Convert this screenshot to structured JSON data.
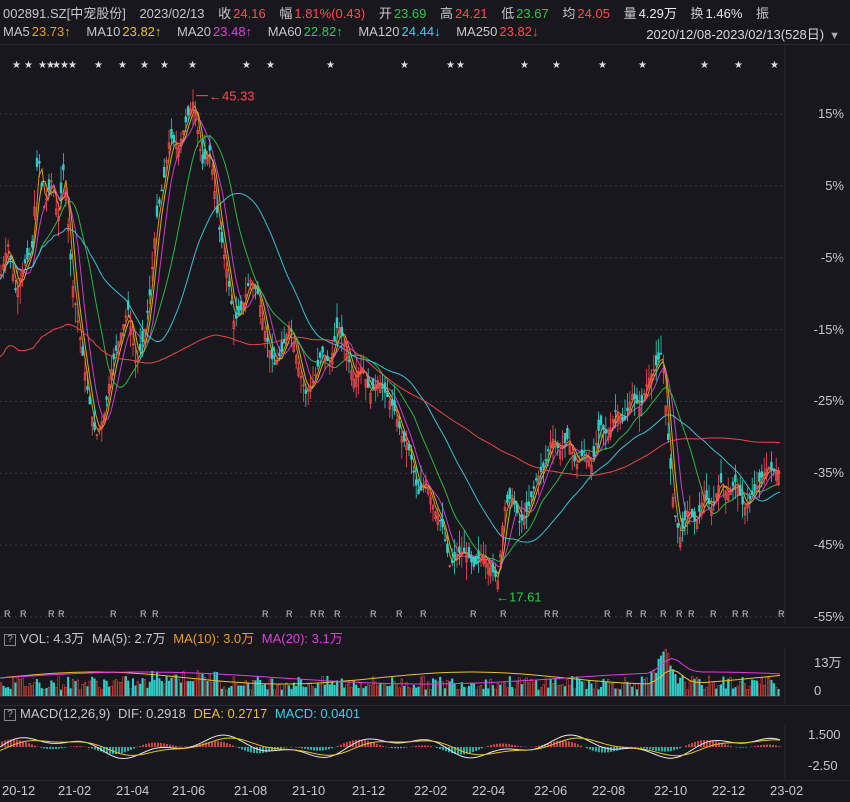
{
  "quote": {
    "symbol": "002891.SZ[中宠股份]",
    "date": "2023/02/13",
    "close_label": "收",
    "close": "24.16",
    "change_label": "幅",
    "change": "1.81%(0.43)",
    "open_label": "开",
    "open": "23.69",
    "high_label": "高",
    "high": "24.21",
    "low_label": "低",
    "low": "23.67",
    "avg_label": "均",
    "avg": "24.05",
    "vol_label": "量",
    "vol": "4.29万",
    "turnover_label": "换",
    "turnover": "1.46%",
    "amp_label": "振"
  },
  "ma": [
    {
      "name": "MA5",
      "value": "23.73↑",
      "color": "#f39b1d"
    },
    {
      "name": "MA10",
      "value": "23.82↑",
      "color": "#e6c32c"
    },
    {
      "name": "MA20",
      "value": "23.48↑",
      "color": "#e23de2"
    },
    {
      "name": "MA60",
      "value": "22.82↑",
      "color": "#2ec84a"
    },
    {
      "name": "MA120",
      "value": "24.44↓",
      "color": "#3fd0e8"
    },
    {
      "name": "MA250",
      "value": "23.82↓",
      "color": "#ff4d4d"
    }
  ],
  "range_label": "2020/12/08-2023/02/13(528日)",
  "price_axis": [
    "15%",
    "5%",
    "-5%",
    "-15%",
    "-25%",
    "-35%",
    "-45%",
    "-55%"
  ],
  "high_marker": "45.33",
  "low_marker": "17.61",
  "vol_panel": {
    "toggle": "?",
    "vol": "VOL: 4.3万",
    "ma5": "MA(5): 2.7万",
    "ma10": "MA(10): 3.0万",
    "ma20": "MA(20): 3.1万",
    "axis_top": "13万",
    "axis_zero": "0"
  },
  "macd_panel": {
    "toggle": "?",
    "name": "MACD(12,26,9)",
    "dif": "DIF: 0.2918",
    "dea": "DEA: 0.2717",
    "macd": "MACD: 0.0401",
    "axis_top": "1.500",
    "axis_bottom": "-2.50"
  },
  "x_axis": [
    "20-12",
    "21-02",
    "21-04",
    "21-06",
    "21-08",
    "21-10",
    "21-12",
    "22-02",
    "22-04",
    "22-06",
    "22-08",
    "22-10",
    "22-12",
    "23-02"
  ],
  "chart_data": {
    "type": "candlestick",
    "x_range": [
      "2020/12/08",
      "2023/02/13"
    ],
    "y_axis_percent": [
      15,
      5,
      -5,
      -15,
      -25,
      -35,
      -45,
      -55
    ],
    "high": 45.33,
    "low": 17.61,
    "close_path_percent": [
      [
        0,
        -8
      ],
      [
        8,
        -3
      ],
      [
        16,
        -10
      ],
      [
        24,
        -6
      ],
      [
        32,
        -4
      ],
      [
        38,
        10
      ],
      [
        44,
        2
      ],
      [
        52,
        6
      ],
      [
        58,
        0
      ],
      [
        64,
        8
      ],
      [
        72,
        -8
      ],
      [
        80,
        -16
      ],
      [
        88,
        -24
      ],
      [
        96,
        -30
      ],
      [
        104,
        -27
      ],
      [
        112,
        -20
      ],
      [
        120,
        -16
      ],
      [
        128,
        -12
      ],
      [
        136,
        -20
      ],
      [
        144,
        -16
      ],
      [
        150,
        -10
      ],
      [
        156,
        0
      ],
      [
        164,
        6
      ],
      [
        170,
        12
      ],
      [
        178,
        10
      ],
      [
        186,
        14
      ],
      [
        194,
        17
      ],
      [
        202,
        8
      ],
      [
        210,
        10
      ],
      [
        218,
        0
      ],
      [
        226,
        -6
      ],
      [
        234,
        -14
      ],
      [
        242,
        -12
      ],
      [
        250,
        -8
      ],
      [
        258,
        -10
      ],
      [
        266,
        -16
      ],
      [
        274,
        -20
      ],
      [
        282,
        -18
      ],
      [
        290,
        -14
      ],
      [
        298,
        -20
      ],
      [
        306,
        -24
      ],
      [
        314,
        -22
      ],
      [
        322,
        -18
      ],
      [
        330,
        -20
      ],
      [
        338,
        -14
      ],
      [
        346,
        -18
      ],
      [
        354,
        -22
      ],
      [
        362,
        -20
      ],
      [
        370,
        -24
      ],
      [
        378,
        -22
      ],
      [
        386,
        -24
      ],
      [
        394,
        -26
      ],
      [
        402,
        -30
      ],
      [
        410,
        -32
      ],
      [
        418,
        -38
      ],
      [
        426,
        -36
      ],
      [
        434,
        -40
      ],
      [
        442,
        -42
      ],
      [
        450,
        -48
      ],
      [
        458,
        -46
      ],
      [
        466,
        -46
      ],
      [
        474,
        -48
      ],
      [
        482,
        -46
      ],
      [
        490,
        -48
      ],
      [
        498,
        -50
      ],
      [
        504,
        -40
      ],
      [
        512,
        -38
      ],
      [
        520,
        -42
      ],
      [
        528,
        -40
      ],
      [
        536,
        -36
      ],
      [
        544,
        -34
      ],
      [
        552,
        -30
      ],
      [
        560,
        -32
      ],
      [
        568,
        -30
      ],
      [
        576,
        -34
      ],
      [
        584,
        -32
      ],
      [
        592,
        -34
      ],
      [
        600,
        -28
      ],
      [
        608,
        -30
      ],
      [
        616,
        -26
      ],
      [
        624,
        -28
      ],
      [
        632,
        -24
      ],
      [
        640,
        -26
      ],
      [
        648,
        -22
      ],
      [
        656,
        -20
      ],
      [
        662,
        -18
      ],
      [
        668,
        -30
      ],
      [
        674,
        -40
      ],
      [
        680,
        -44
      ],
      [
        688,
        -40
      ],
      [
        696,
        -42
      ],
      [
        704,
        -38
      ],
      [
        712,
        -40
      ],
      [
        720,
        -36
      ],
      [
        728,
        -38
      ],
      [
        736,
        -36
      ],
      [
        744,
        -40
      ],
      [
        752,
        -38
      ],
      [
        760,
        -36
      ],
      [
        768,
        -34
      ],
      [
        776,
        -35
      ],
      [
        780,
        -35
      ]
    ]
  }
}
